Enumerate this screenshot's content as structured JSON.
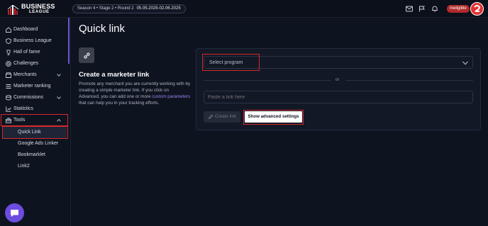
{
  "brand": {
    "name": "BUSINESS",
    "sub": "LEAGUE"
  },
  "header": {
    "season": "Season 4 • Stage 2 • Round 2",
    "dates": "05.05.2025-02.06.2025",
    "status_badge": "Ineligible",
    "icons": [
      "mail-icon",
      "flag-icon",
      "bell-icon"
    ]
  },
  "sidebar": {
    "items": [
      {
        "label": "Dashboard",
        "icon": "home-icon"
      },
      {
        "label": "Business League",
        "icon": "shield-icon"
      },
      {
        "label": "Hall of fame",
        "icon": "trophy-icon"
      },
      {
        "label": "Challenges",
        "icon": "target-icon"
      },
      {
        "label": "Merchants",
        "icon": "store-icon",
        "expandable": true
      },
      {
        "label": "Marketer ranking",
        "icon": "list-icon"
      },
      {
        "label": "Commissions",
        "icon": "coins-icon",
        "expandable": true
      },
      {
        "label": "Statistics",
        "icon": "chart-icon"
      },
      {
        "label": "Tools",
        "icon": "toolbox-icon",
        "expandable": true,
        "expanded": true
      }
    ],
    "tools_sub": [
      {
        "label": "Quick Link",
        "active": true
      },
      {
        "label": "Google Ads Linker"
      },
      {
        "label": "Bookmarklet"
      },
      {
        "label": "Link2"
      }
    ]
  },
  "main": {
    "title": "Quick link",
    "section_title": "Create a marketer link",
    "desc_part1": "Promote any merchant you are currently working with by creating a simple marketer link. If you click on Advanced, you can add one or more ",
    "desc_link": "custom parameters",
    "desc_part2": " that can help you in your tracking efforts.",
    "select_placeholder": "Select program",
    "or_text": "or",
    "paste_placeholder": "Paste a link here",
    "create_label": "Create link",
    "advanced_label": "Show advanced settings"
  },
  "colors": {
    "accent": "#6d4ce0",
    "highlight": "#d6282c",
    "badge": "#b12a2a"
  }
}
